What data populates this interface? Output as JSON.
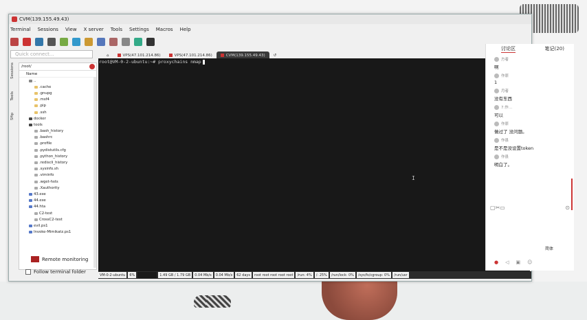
{
  "window": {
    "title": "CVM(139.155.49.43)"
  },
  "menu": [
    "Terminal",
    "Sessions",
    "View",
    "X server",
    "Tools",
    "Settings",
    "Macros",
    "Help"
  ],
  "toolbar_icons": [
    {
      "name": "settings-icon",
      "color": "#b44"
    },
    {
      "name": "star-icon",
      "color": "#c33"
    },
    {
      "name": "globe-icon",
      "color": "#37a"
    },
    {
      "name": "user-icon",
      "color": "#555"
    },
    {
      "name": "bug-icon",
      "color": "#7a4"
    },
    {
      "name": "split-icon",
      "color": "#39c"
    },
    {
      "name": "multiexec-icon",
      "color": "#c93"
    },
    {
      "name": "tunnel-icon",
      "color": "#57b"
    },
    {
      "name": "package-icon",
      "color": "#a66"
    },
    {
      "name": "gear-icon",
      "color": "#888"
    },
    {
      "name": "xserver-icon",
      "color": "#3a8"
    },
    {
      "name": "exit-icon",
      "color": "#333"
    }
  ],
  "quick_connect": {
    "placeholder": "Quick connect..."
  },
  "tabs": [
    {
      "label": "VPS(47.101.214.86)",
      "active": false
    },
    {
      "label": "VPS(47.101.214.86)",
      "active": false
    },
    {
      "label": "CVM(139.155.49.43)",
      "active": true
    }
  ],
  "side_tabs": [
    "Sessions",
    "Tools",
    "Sftp"
  ],
  "browser": {
    "path": "/root/",
    "column": "Name",
    "files": [
      {
        "name": "..",
        "type": "up"
      },
      {
        "name": ".cache",
        "type": "folder"
      },
      {
        "name": ".gnupg",
        "type": "folder"
      },
      {
        "name": ".msf4",
        "type": "folder"
      },
      {
        "name": ".pip",
        "type": "folder"
      },
      {
        "name": ".ssh",
        "type": "folder"
      },
      {
        "name": "docker",
        "type": "dark"
      },
      {
        "name": "tools",
        "type": "dark"
      },
      {
        "name": ".bash_history",
        "type": "file"
      },
      {
        "name": ".bashrc",
        "type": "file"
      },
      {
        "name": ".profile",
        "type": "file"
      },
      {
        "name": ".pydistutils.cfg",
        "type": "file"
      },
      {
        "name": ".python_history",
        "type": "file"
      },
      {
        "name": ".rediscli_history",
        "type": "file"
      },
      {
        "name": ".sysinfo.sh",
        "type": "file"
      },
      {
        "name": ".viminfo",
        "type": "file"
      },
      {
        "name": ".wget-hsts",
        "type": "file"
      },
      {
        "name": ".Xauthority",
        "type": "file"
      },
      {
        "name": "43.exe",
        "type": "exe"
      },
      {
        "name": "44.exe",
        "type": "exe"
      },
      {
        "name": "44.hta",
        "type": "exe"
      },
      {
        "name": "C2-test",
        "type": "file"
      },
      {
        "name": "CrossC2-test",
        "type": "file"
      },
      {
        "name": "evil.ps1",
        "type": "exe"
      },
      {
        "name": "Invoke-Mimikatz.ps1",
        "type": "exe"
      }
    ],
    "remote_monitoring": "Remote monitoring",
    "follow_terminal": "Follow terminal folder"
  },
  "terminal": {
    "prompt": "root@VM-0-2-ubuntu:~#",
    "command": "proxychains nmap"
  },
  "status_bar": [
    {
      "text": "VM-0-2-ubuntu",
      "kind": "text"
    },
    {
      "text": "6%",
      "kind": "text"
    },
    {
      "text": "",
      "kind": "dark"
    },
    {
      "text": "1.49 GB / 1.79 GB",
      "kind": "text"
    },
    {
      "text": "0.04 Mb/s",
      "kind": "text"
    },
    {
      "text": "0.04 Mb/s",
      "kind": "text"
    },
    {
      "text": "62 days",
      "kind": "text"
    },
    {
      "text": "root  root  root  root  root",
      "kind": "text"
    },
    {
      "text": "/run: 4%",
      "kind": "text"
    },
    {
      "text": "/: 25%",
      "kind": "text"
    },
    {
      "text": "/run/lock: 0%",
      "kind": "text"
    },
    {
      "text": "/sys/fs/cgroup: 0%",
      "kind": "text"
    },
    {
      "text": "/run/usr",
      "kind": "text"
    }
  ],
  "chat": {
    "tab_discussion": "讨论区",
    "tab_notes": "笔记(20)",
    "messages": [
      {
        "user": "方者",
        "text": "啊"
      },
      {
        "user": "作原",
        "text": "1"
      },
      {
        "user": "月者",
        "text": "没有东西"
      },
      {
        "user": "7.作…",
        "text": "可以"
      },
      {
        "user": "作原",
        "text": "做过了 没问题。"
      },
      {
        "user": "作县",
        "text": "是不是没设置token"
      },
      {
        "user": "作县",
        "text": "明白了。"
      }
    ],
    "lang": "简体",
    "icons": [
      "note-icon",
      "screenshot-icon",
      "image-icon",
      "help-icon"
    ],
    "bottom_icons": [
      "mic-icon",
      "speaker-icon",
      "gift-icon",
      "emoji-icon"
    ]
  }
}
